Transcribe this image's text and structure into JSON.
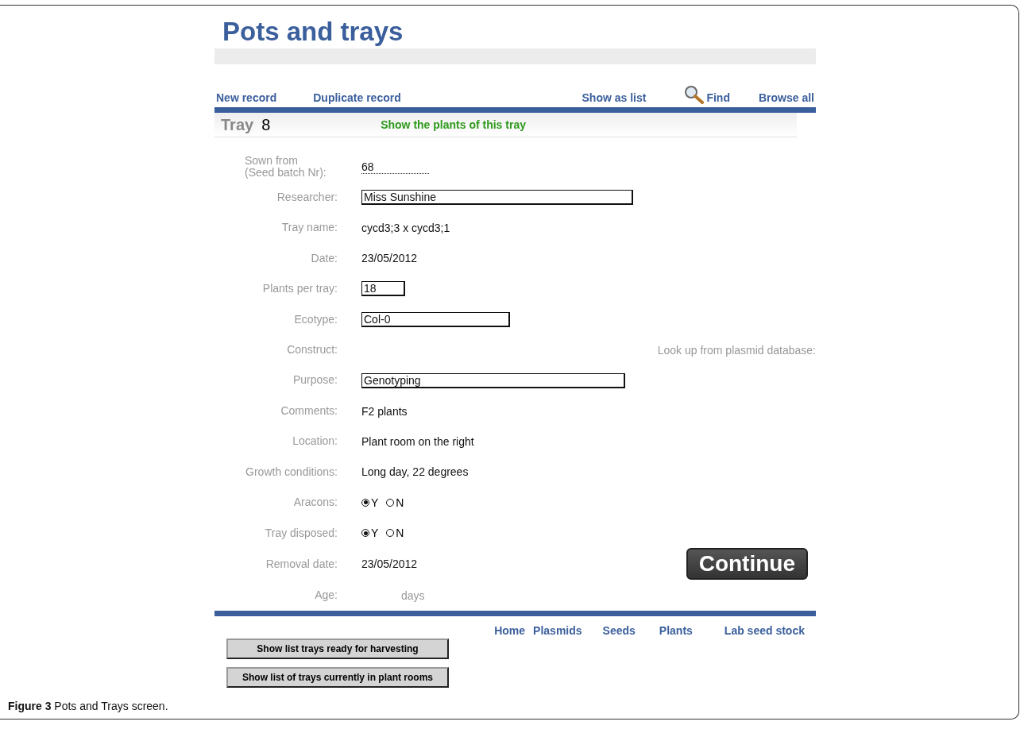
{
  "title": "Pots and trays",
  "toolbar": [
    {
      "label": "New record",
      "kind": "link"
    },
    {
      "label": "Duplicate record",
      "kind": "link"
    },
    {
      "label": "Show as list",
      "kind": "link"
    },
    {
      "label": "Find",
      "kind": "search"
    },
    {
      "label": "Browse all",
      "kind": "link"
    }
  ],
  "record": {
    "type_label": "Tray",
    "number": "8",
    "link": "Show the plants of this tray"
  },
  "fields": [
    {
      "label": "Sown from\n(Seed batch Nr):",
      "kind": "dotted",
      "value": "68"
    },
    {
      "label": "Researcher:",
      "kind": "input",
      "value": "Miss Sunshine"
    },
    {
      "label": "Tray name:",
      "kind": "text",
      "value": "cycd3;3 x cycd3;1"
    },
    {
      "label": "Date:",
      "kind": "text",
      "value": "23/05/2012"
    },
    {
      "label": "Plants per tray:",
      "kind": "input",
      "value": "18"
    },
    {
      "label": "Ecotype:",
      "kind": "input",
      "value": "Col-0"
    },
    {
      "label": "Construct:",
      "kind": "empty",
      "aside": "Look up from plasmid database:"
    },
    {
      "label": "Purpose:",
      "kind": "input",
      "value": "Genotyping"
    },
    {
      "label": "Comments:",
      "kind": "text",
      "value": "F2 plants"
    },
    {
      "label": "Location:",
      "kind": "text",
      "value": "Plant room on the right"
    },
    {
      "label": "Growth conditions:",
      "kind": "text",
      "value": "Long day, 22 degrees"
    },
    {
      "label": "Aracons:",
      "kind": "radio",
      "options": [
        {
          "label": "Y",
          "selected": true
        },
        {
          "label": "N",
          "selected": false
        }
      ]
    },
    {
      "label": "Tray disposed:",
      "kind": "radio",
      "options": [
        {
          "label": "Y",
          "selected": true
        },
        {
          "label": "N",
          "selected": false
        }
      ]
    },
    {
      "label": "Removal date:",
      "kind": "text",
      "value": "23/05/2012",
      "button": "Continue"
    },
    {
      "label": "Age:",
      "kind": "unit",
      "value": "days"
    }
  ],
  "nav": [
    "Home",
    "Plasmids",
    "Seeds",
    "Plants",
    "Lab seed stock"
  ],
  "buttons": [
    "Show list trays ready for harvesting",
    "Show list of trays currently in plant rooms"
  ],
  "caption": "**Figure 3** Pots and Trays screen."
}
